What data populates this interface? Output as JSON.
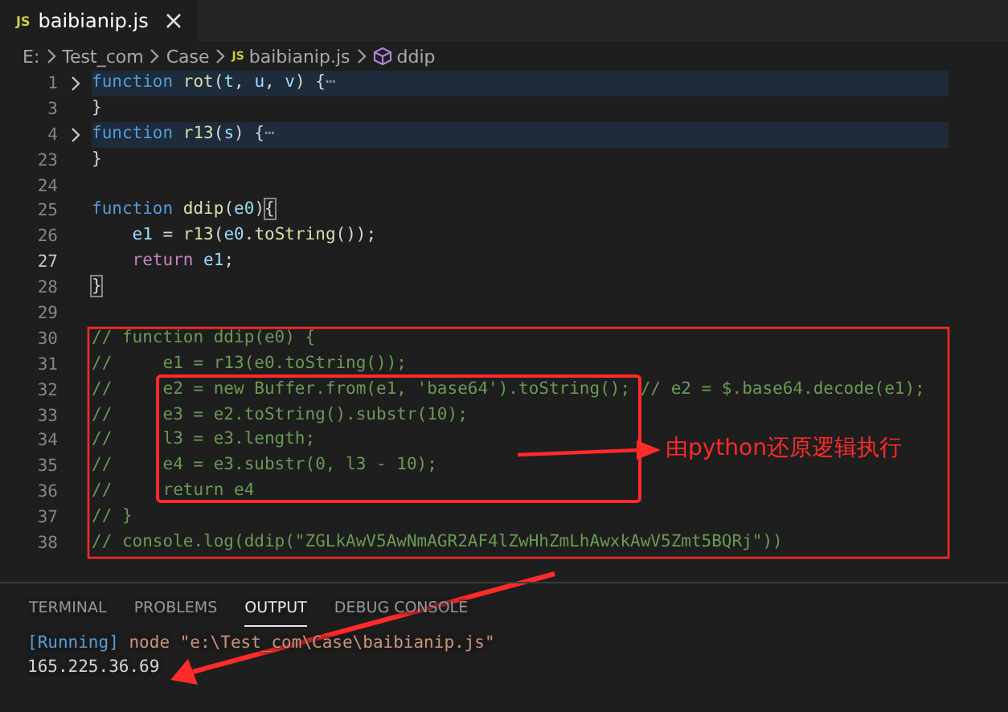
{
  "tabs": [
    {
      "label": "baibianip.js",
      "badge": "JS",
      "selected": true
    }
  ],
  "breadcrumb": [
    {
      "label": "E:",
      "kind": "folder"
    },
    {
      "label": "Test_com",
      "kind": "folder"
    },
    {
      "label": "Case",
      "kind": "folder"
    },
    {
      "label": "baibianip.js",
      "kind": "file",
      "badge": "JS"
    },
    {
      "label": "ddip",
      "kind": "symbol"
    }
  ],
  "editor": {
    "lines": [
      {
        "number": "1",
        "folded": true,
        "current": false,
        "tokens": [
          {
            "kind": "kw",
            "text": "function "
          },
          {
            "kind": "fn",
            "text": "rot"
          },
          {
            "kind": "plain",
            "text": "("
          },
          {
            "kind": "param",
            "text": "t"
          },
          {
            "kind": "plain",
            "text": ", "
          },
          {
            "kind": "param",
            "text": "u"
          },
          {
            "kind": "plain",
            "text": ", "
          },
          {
            "kind": "param",
            "text": "v"
          },
          {
            "kind": "plain",
            "text": ") {"
          },
          {
            "kind": "dim",
            "text": "⋯"
          }
        ]
      },
      {
        "number": "3",
        "folded": false,
        "current": false,
        "tokens": [
          {
            "kind": "plain",
            "text": "}"
          }
        ]
      },
      {
        "number": "4",
        "folded": true,
        "current": false,
        "tokens": [
          {
            "kind": "kw",
            "text": "function "
          },
          {
            "kind": "fn",
            "text": "r13"
          },
          {
            "kind": "plain",
            "text": "("
          },
          {
            "kind": "param",
            "text": "s"
          },
          {
            "kind": "plain",
            "text": ") {"
          },
          {
            "kind": "dim",
            "text": "⋯"
          }
        ]
      },
      {
        "number": "23",
        "folded": false,
        "current": false,
        "tokens": [
          {
            "kind": "plain",
            "text": "}"
          }
        ]
      },
      {
        "number": "24",
        "current": false
      },
      {
        "number": "25",
        "folded": false,
        "current": false,
        "tokens": [
          {
            "kind": "kw",
            "text": "function "
          },
          {
            "kind": "fn",
            "text": "ddip"
          },
          {
            "kind": "plain",
            "text": "("
          },
          {
            "kind": "param",
            "text": "e0"
          },
          {
            "kind": "plain",
            "text": ")"
          },
          {
            "kind": "match",
            "text": "{"
          }
        ]
      },
      {
        "number": "26",
        "folded": false,
        "current": false,
        "indented": true,
        "tokens": [
          {
            "kind": "param",
            "text": "e1"
          },
          {
            "kind": "plain",
            "text": " = "
          },
          {
            "kind": "fn",
            "text": "r13"
          },
          {
            "kind": "plain",
            "text": "("
          },
          {
            "kind": "param",
            "text": "e0"
          },
          {
            "kind": "plain",
            "text": "."
          },
          {
            "kind": "fn",
            "text": "toString"
          },
          {
            "kind": "plain",
            "text": "());"
          }
        ]
      },
      {
        "number": "27",
        "folded": false,
        "current": true,
        "indented": true,
        "tokens": [
          {
            "kind": "ret",
            "text": "return "
          },
          {
            "kind": "param",
            "text": "e1"
          },
          {
            "kind": "plain",
            "text": ";"
          }
        ]
      },
      {
        "number": "28",
        "folded": false,
        "current": false,
        "tokens": [
          {
            "kind": "match",
            "text": "}"
          }
        ]
      },
      {
        "number": "29",
        "current": false
      },
      {
        "number": "30",
        "folded": false,
        "current": false,
        "tokens": [
          {
            "kind": "comment",
            "text": "// function ddip(e0) {"
          }
        ]
      },
      {
        "number": "31",
        "folded": false,
        "current": false,
        "tokens": [
          {
            "kind": "comment",
            "text": "//     e1 = r13(e0.toString());"
          }
        ]
      },
      {
        "number": "32",
        "folded": false,
        "current": false,
        "tokens": [
          {
            "kind": "comment",
            "text": "//     e2 = new Buffer.from(e1, 'base64').toString(); // e2 = $.base64.decode(e1);"
          }
        ]
      },
      {
        "number": "33",
        "folded": false,
        "current": false,
        "tokens": [
          {
            "kind": "comment",
            "text": "//     e3 = e2.toString().substr(10);"
          }
        ]
      },
      {
        "number": "34",
        "folded": false,
        "current": false,
        "tokens": [
          {
            "kind": "comment",
            "text": "//     l3 = e3.length;"
          }
        ]
      },
      {
        "number": "35",
        "folded": false,
        "current": false,
        "tokens": [
          {
            "kind": "comment",
            "text": "//     e4 = e3.substr(0, l3 - 10);"
          }
        ]
      },
      {
        "number": "36",
        "folded": false,
        "current": false,
        "tokens": [
          {
            "kind": "comment",
            "text": "//     return e4"
          }
        ]
      },
      {
        "number": "37",
        "folded": false,
        "current": false,
        "tokens": [
          {
            "kind": "comment",
            "text": "// }"
          }
        ]
      },
      {
        "number": "38",
        "folded": false,
        "current": false,
        "tokens": [
          {
            "kind": "comment",
            "text": "// console.log(ddip(\"ZGLkAwV5AwNmAGR2AF4lZwHhZmLhAwxkAwV5Zmt5BQRj\"))"
          }
        ]
      }
    ]
  },
  "panel": {
    "tabs": [
      {
        "label": "TERMINAL",
        "selected": false
      },
      {
        "label": "PROBLEMS",
        "selected": false
      },
      {
        "label": "OUTPUT",
        "selected": true
      },
      {
        "label": "DEBUG CONSOLE",
        "selected": false
      }
    ],
    "output": [
      {
        "tokens": [
          {
            "kind": "info",
            "text": "[Running]"
          },
          {
            "kind": "cmd",
            "text": " node \"e:\\Test_com\\Case\\baibianip.js\""
          }
        ]
      },
      {
        "tokens": [
          {
            "kind": "plain",
            "text": "165.225.36.69"
          }
        ]
      }
    ]
  },
  "annotation": {
    "callout": "由python还原逻辑执行"
  }
}
